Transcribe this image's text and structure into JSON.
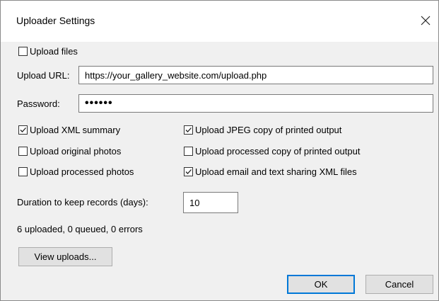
{
  "window": {
    "title": "Uploader Settings",
    "close_icon": "close-icon"
  },
  "upload_files": {
    "label": "Upload files",
    "checked": false
  },
  "upload_url": {
    "label": "Upload URL:",
    "value": "https://your_gallery_website.com/upload.php"
  },
  "password": {
    "label": "Password:",
    "value": "••••••"
  },
  "options_left": [
    {
      "label": "Upload XML summary",
      "checked": true
    },
    {
      "label": "Upload original photos",
      "checked": false
    },
    {
      "label": "Upload processed photos",
      "checked": false
    }
  ],
  "options_right": [
    {
      "label": "Upload JPEG copy of printed output",
      "checked": true
    },
    {
      "label": "Upload processed copy of printed output",
      "checked": false
    },
    {
      "label": "Upload email and text sharing XML files",
      "checked": true
    }
  ],
  "duration": {
    "label": "Duration to keep records (days):",
    "value": "10"
  },
  "status": "6 uploaded, 0 queued, 0 errors",
  "buttons": {
    "view_uploads": "View uploads...",
    "ok": "OK",
    "cancel": "Cancel"
  },
  "colors": {
    "dialog_bg": "#f0f0f0",
    "titlebar_bg": "#ffffff",
    "default_button_border": "#0078d7"
  }
}
